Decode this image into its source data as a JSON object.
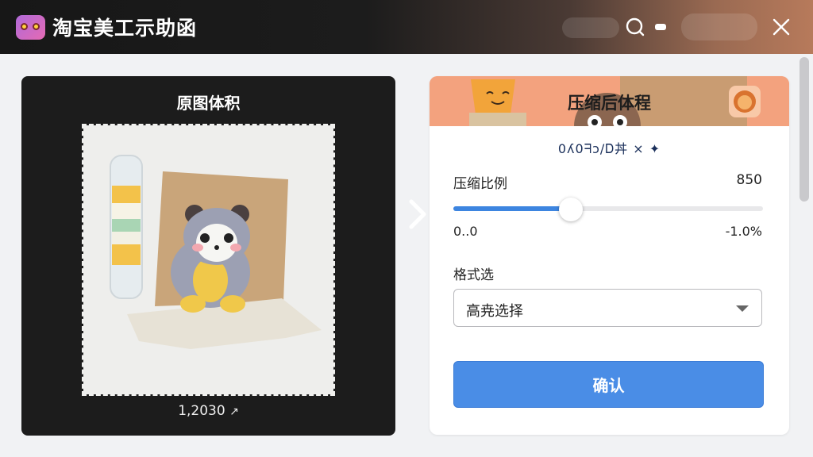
{
  "app": {
    "title": "淘宝美工示助函"
  },
  "left": {
    "title": "原图体积",
    "size": "1,2030"
  },
  "right": {
    "title": "压缩后体程",
    "subline": "0ʎ0ᖷɔ/Ꭰ丼 × ✦",
    "ratio_label": "压缩比例",
    "ratio_value": "850",
    "range_min": "0..0",
    "range_max": "-1.0%",
    "slider_fraction": 0.38,
    "format_label": "格式选",
    "format_selected": "高尭选择",
    "confirm_label": "确认"
  },
  "colors": {
    "accent": "#4a8de6",
    "banner": "#f3a27e",
    "dark_panel": "#1c1c1c"
  }
}
